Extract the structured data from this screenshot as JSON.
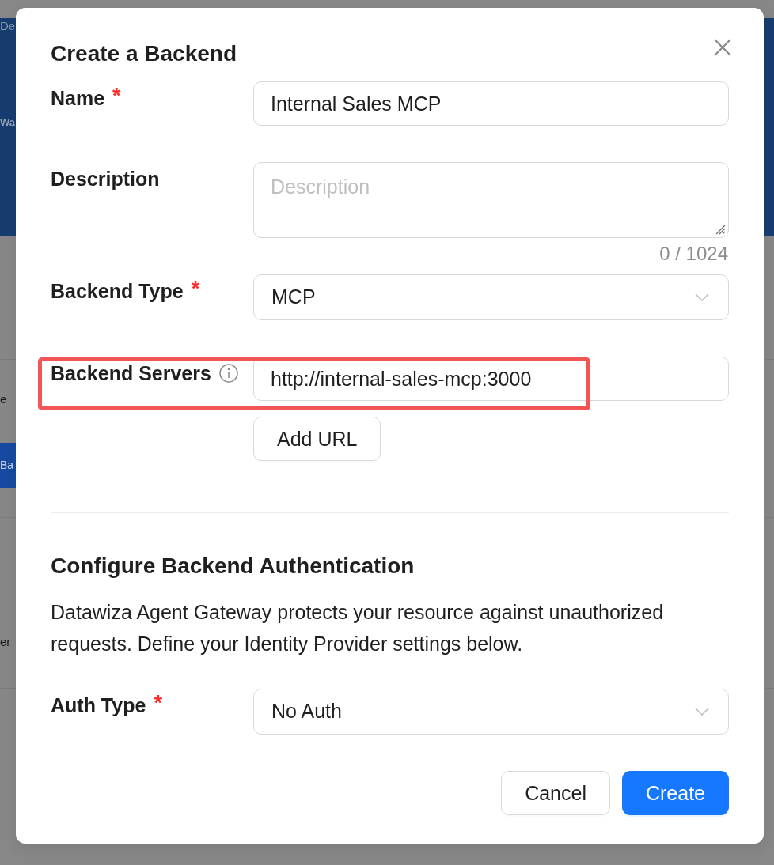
{
  "background_page": {
    "header": [
      {
        "kind": "subtitle",
        "text": "De"
      },
      {
        "kind": "title",
        "text": "Wa"
      }
    ],
    "table_rows": [
      {
        "cells": [
          {
            "kind": "text",
            "text": "e"
          },
          {
            "kind": "button",
            "text": "Ba"
          }
        ]
      },
      {
        "cells": [
          {
            "kind": "text",
            "text": "er"
          }
        ]
      }
    ]
  },
  "dialog": {
    "title": "Create a Backend",
    "fields": [
      {
        "kind": "text",
        "label": "Name",
        "required_mark": "*",
        "value": "Internal Sales MCP"
      },
      {
        "kind": "textarea",
        "label": "Description",
        "placeholder": "Description",
        "counter": "0 / 1024"
      },
      {
        "kind": "select",
        "label": "Backend Type",
        "required_mark": "*",
        "value": "MCP"
      },
      {
        "kind": "url_list",
        "label": "Backend Servers",
        "info": true,
        "value": "http://internal-sales-mcp:3000",
        "highlighted": true,
        "add_button": "Add URL"
      }
    ],
    "section": {
      "title": "Configure Backend Authentication",
      "text": "Datawiza Agent Gateway protects your resource against unauthorized requests. Define your Identity Provider settings below."
    },
    "auth_fields": [
      {
        "kind": "select",
        "label": "Auth Type",
        "required_mark": "*",
        "value": "No Auth"
      }
    ],
    "buttons": [
      {
        "kind": "default",
        "label": "Cancel"
      },
      {
        "kind": "primary",
        "label": "Create"
      }
    ]
  }
}
